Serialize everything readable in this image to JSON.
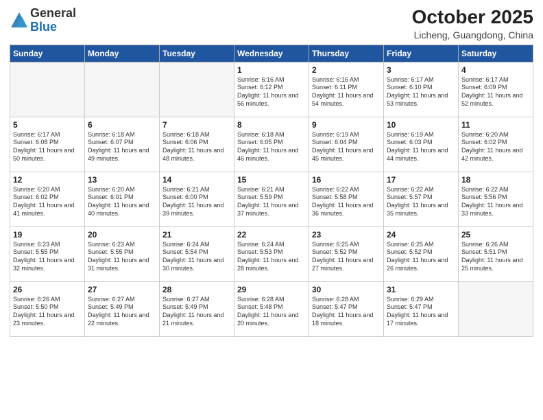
{
  "logo": {
    "general": "General",
    "blue": "Blue"
  },
  "header": {
    "month": "October 2025",
    "location": "Licheng, Guangdong, China"
  },
  "weekdays": [
    "Sunday",
    "Monday",
    "Tuesday",
    "Wednesday",
    "Thursday",
    "Friday",
    "Saturday"
  ],
  "weeks": [
    [
      {
        "day": "",
        "text": ""
      },
      {
        "day": "",
        "text": ""
      },
      {
        "day": "",
        "text": ""
      },
      {
        "day": "1",
        "text": "Sunrise: 6:16 AM\nSunset: 6:12 PM\nDaylight: 11 hours and 56 minutes."
      },
      {
        "day": "2",
        "text": "Sunrise: 6:16 AM\nSunset: 6:11 PM\nDaylight: 11 hours and 54 minutes."
      },
      {
        "day": "3",
        "text": "Sunrise: 6:17 AM\nSunset: 6:10 PM\nDaylight: 11 hours and 53 minutes."
      },
      {
        "day": "4",
        "text": "Sunrise: 6:17 AM\nSunset: 6:09 PM\nDaylight: 11 hours and 52 minutes."
      }
    ],
    [
      {
        "day": "5",
        "text": "Sunrise: 6:17 AM\nSunset: 6:08 PM\nDaylight: 11 hours and 50 minutes."
      },
      {
        "day": "6",
        "text": "Sunrise: 6:18 AM\nSunset: 6:07 PM\nDaylight: 11 hours and 49 minutes."
      },
      {
        "day": "7",
        "text": "Sunrise: 6:18 AM\nSunset: 6:06 PM\nDaylight: 11 hours and 48 minutes."
      },
      {
        "day": "8",
        "text": "Sunrise: 6:18 AM\nSunset: 6:05 PM\nDaylight: 11 hours and 46 minutes."
      },
      {
        "day": "9",
        "text": "Sunrise: 6:19 AM\nSunset: 6:04 PM\nDaylight: 11 hours and 45 minutes."
      },
      {
        "day": "10",
        "text": "Sunrise: 6:19 AM\nSunset: 6:03 PM\nDaylight: 11 hours and 44 minutes."
      },
      {
        "day": "11",
        "text": "Sunrise: 6:20 AM\nSunset: 6:02 PM\nDaylight: 11 hours and 42 minutes."
      }
    ],
    [
      {
        "day": "12",
        "text": "Sunrise: 6:20 AM\nSunset: 6:02 PM\nDaylight: 11 hours and 41 minutes."
      },
      {
        "day": "13",
        "text": "Sunrise: 6:20 AM\nSunset: 6:01 PM\nDaylight: 11 hours and 40 minutes."
      },
      {
        "day": "14",
        "text": "Sunrise: 6:21 AM\nSunset: 6:00 PM\nDaylight: 11 hours and 39 minutes."
      },
      {
        "day": "15",
        "text": "Sunrise: 6:21 AM\nSunset: 5:59 PM\nDaylight: 11 hours and 37 minutes."
      },
      {
        "day": "16",
        "text": "Sunrise: 6:22 AM\nSunset: 5:58 PM\nDaylight: 11 hours and 36 minutes."
      },
      {
        "day": "17",
        "text": "Sunrise: 6:22 AM\nSunset: 5:57 PM\nDaylight: 11 hours and 35 minutes."
      },
      {
        "day": "18",
        "text": "Sunrise: 6:22 AM\nSunset: 5:56 PM\nDaylight: 11 hours and 33 minutes."
      }
    ],
    [
      {
        "day": "19",
        "text": "Sunrise: 6:23 AM\nSunset: 5:55 PM\nDaylight: 11 hours and 32 minutes."
      },
      {
        "day": "20",
        "text": "Sunrise: 6:23 AM\nSunset: 5:55 PM\nDaylight: 11 hours and 31 minutes."
      },
      {
        "day": "21",
        "text": "Sunrise: 6:24 AM\nSunset: 5:54 PM\nDaylight: 11 hours and 30 minutes."
      },
      {
        "day": "22",
        "text": "Sunrise: 6:24 AM\nSunset: 5:53 PM\nDaylight: 11 hours and 28 minutes."
      },
      {
        "day": "23",
        "text": "Sunrise: 6:25 AM\nSunset: 5:52 PM\nDaylight: 11 hours and 27 minutes."
      },
      {
        "day": "24",
        "text": "Sunrise: 6:25 AM\nSunset: 5:52 PM\nDaylight: 11 hours and 26 minutes."
      },
      {
        "day": "25",
        "text": "Sunrise: 6:26 AM\nSunset: 5:51 PM\nDaylight: 11 hours and 25 minutes."
      }
    ],
    [
      {
        "day": "26",
        "text": "Sunrise: 6:26 AM\nSunset: 5:50 PM\nDaylight: 11 hours and 23 minutes."
      },
      {
        "day": "27",
        "text": "Sunrise: 6:27 AM\nSunset: 5:49 PM\nDaylight: 11 hours and 22 minutes."
      },
      {
        "day": "28",
        "text": "Sunrise: 6:27 AM\nSunset: 5:49 PM\nDaylight: 11 hours and 21 minutes."
      },
      {
        "day": "29",
        "text": "Sunrise: 6:28 AM\nSunset: 5:48 PM\nDaylight: 11 hours and 20 minutes."
      },
      {
        "day": "30",
        "text": "Sunrise: 6:28 AM\nSunset: 5:47 PM\nDaylight: 11 hours and 18 minutes."
      },
      {
        "day": "31",
        "text": "Sunrise: 6:29 AM\nSunset: 5:47 PM\nDaylight: 11 hours and 17 minutes."
      },
      {
        "day": "",
        "text": ""
      }
    ]
  ]
}
